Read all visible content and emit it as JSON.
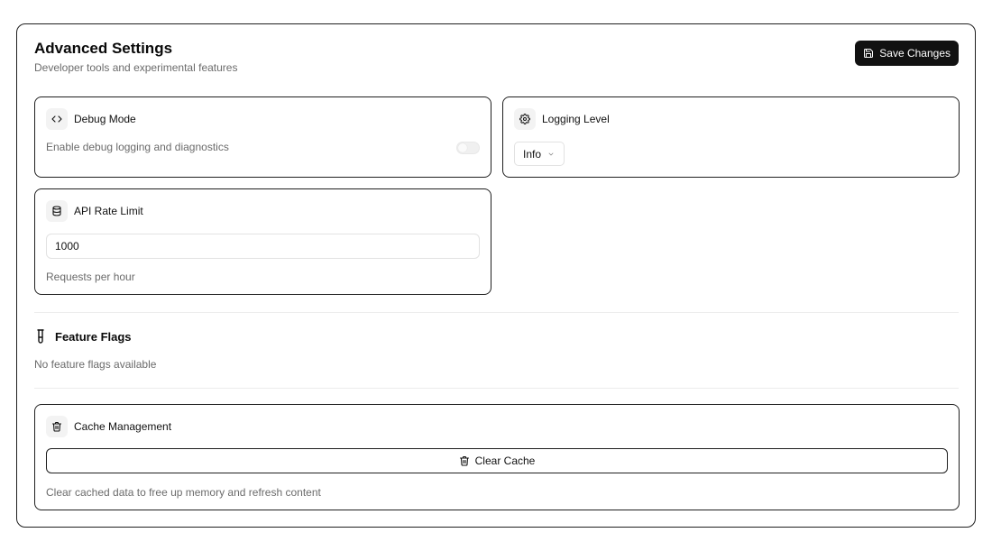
{
  "header": {
    "title": "Advanced Settings",
    "subtitle": "Developer tools and experimental features",
    "save_label": "Save Changes"
  },
  "debug": {
    "title": "Debug Mode",
    "description": "Enable debug logging and diagnostics",
    "enabled": false
  },
  "logging": {
    "title": "Logging Level",
    "selected": "Info"
  },
  "rate_limit": {
    "title": "API Rate Limit",
    "value": "1000",
    "hint": "Requests per hour"
  },
  "feature_flags": {
    "title": "Feature Flags",
    "empty_text": "No feature flags available"
  },
  "cache": {
    "title": "Cache Management",
    "button_label": "Clear Cache",
    "description": "Clear cached data to free up memory and refresh content"
  },
  "icons": {
    "save": "save-icon",
    "code": "code-icon",
    "settings": "gear-icon",
    "database": "database-icon",
    "flask": "test-tube-icon",
    "trash": "trash-icon",
    "chevron": "chevron-down-icon"
  }
}
